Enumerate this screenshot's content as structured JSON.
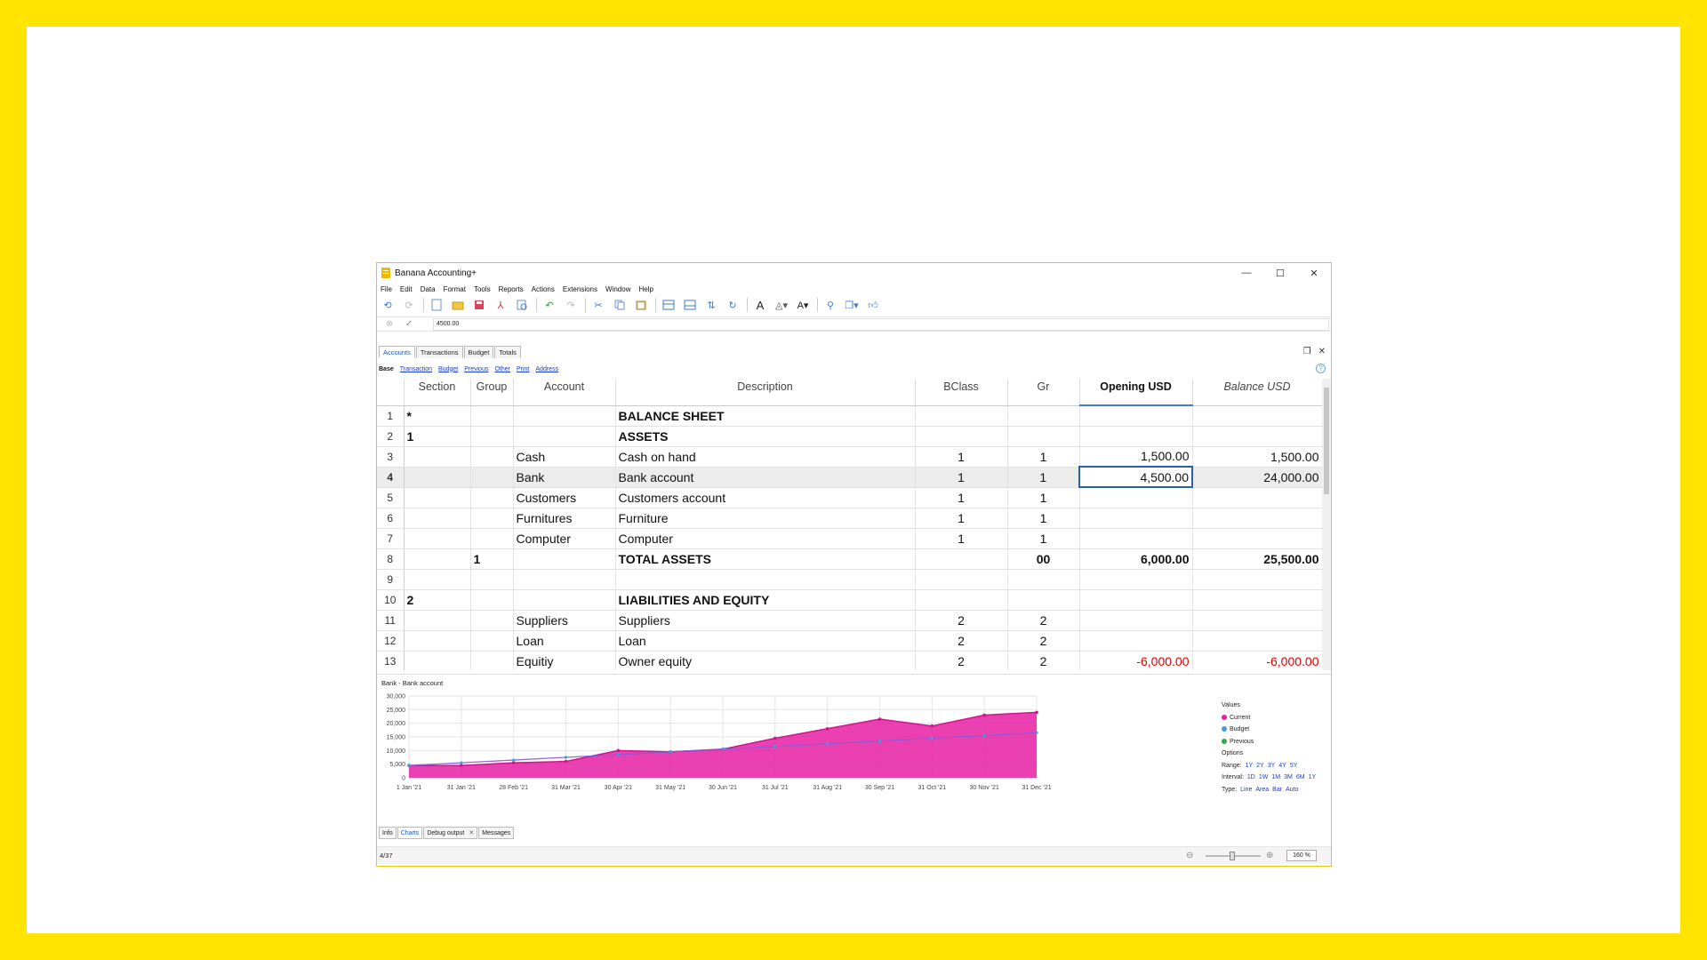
{
  "window": {
    "title": "Banana Accounting+"
  },
  "window_controls": {
    "minimize": "—",
    "maximize": "☐",
    "close": "✕"
  },
  "menu": [
    "File",
    "Edit",
    "Data",
    "Format",
    "Tools",
    "Reports",
    "Actions",
    "Extensions",
    "Window",
    "Help"
  ],
  "formula_bar": {
    "value": "4500.00"
  },
  "tabs": [
    "Accounts",
    "Transactions",
    "Budget",
    "Totals"
  ],
  "subtabs": [
    "Base",
    "Transaction",
    "Budget",
    "Previous",
    "Other",
    "Print",
    "Address"
  ],
  "table": {
    "headers": [
      "Section",
      "Group",
      "Account",
      "Description",
      "BClass",
      "Gr",
      "Opening USD",
      "Balance USD"
    ],
    "rows": [
      {
        "n": "1",
        "section": "*",
        "group": "",
        "account": "",
        "desc": "BALANCE SHEET",
        "bclass": "",
        "gr": "",
        "opening": "",
        "balance": ""
      },
      {
        "n": "2",
        "section": "1",
        "group": "",
        "account": "",
        "desc": "ASSETS",
        "bclass": "",
        "gr": "",
        "opening": "",
        "balance": ""
      },
      {
        "n": "3",
        "section": "",
        "group": "",
        "account": "Cash",
        "desc": "Cash on hand",
        "bclass": "1",
        "gr": "1",
        "opening": "1,500.00",
        "balance": "1,500.00"
      },
      {
        "n": "4",
        "section": "",
        "group": "",
        "account": "Bank",
        "desc": "Bank account",
        "bclass": "1",
        "gr": "1",
        "opening": "4,500.00",
        "balance": "24,000.00"
      },
      {
        "n": "5",
        "section": "",
        "group": "",
        "account": "Customers",
        "desc": "Customers account",
        "bclass": "1",
        "gr": "1",
        "opening": "",
        "balance": ""
      },
      {
        "n": "6",
        "section": "",
        "group": "",
        "account": "Furnitures",
        "desc": "Furniture",
        "bclass": "1",
        "gr": "1",
        "opening": "",
        "balance": ""
      },
      {
        "n": "7",
        "section": "",
        "group": "",
        "account": "Computer",
        "desc": "Computer",
        "bclass": "1",
        "gr": "1",
        "opening": "",
        "balance": ""
      },
      {
        "n": "8",
        "section": "",
        "group": "1",
        "account": "",
        "desc": "TOTAL ASSETS",
        "bclass": "",
        "gr": "00",
        "opening": "6,000.00",
        "balance": "25,500.00"
      },
      {
        "n": "9",
        "section": "",
        "group": "",
        "account": "",
        "desc": "",
        "bclass": "",
        "gr": "",
        "opening": "",
        "balance": ""
      },
      {
        "n": "10",
        "section": "2",
        "group": "",
        "account": "",
        "desc": "LIABILITIES AND EQUITY",
        "bclass": "",
        "gr": "",
        "opening": "",
        "balance": ""
      },
      {
        "n": "11",
        "section": "",
        "group": "",
        "account": "Suppliers",
        "desc": "Suppliers",
        "bclass": "2",
        "gr": "2",
        "opening": "",
        "balance": ""
      },
      {
        "n": "12",
        "section": "",
        "group": "",
        "account": "Loan",
        "desc": "Loan",
        "bclass": "2",
        "gr": "2",
        "opening": "",
        "balance": ""
      },
      {
        "n": "13",
        "section": "",
        "group": "",
        "account": "Equitiy",
        "desc": "Owner equity",
        "bclass": "2",
        "gr": "2",
        "opening": "-6,000.00",
        "balance": "-6,000.00"
      }
    ]
  },
  "chart_panel": {
    "title": "Bank - Bank account",
    "legend": {
      "values_label": "Values",
      "current": "Current",
      "budget": "Budget",
      "previous": "Previous",
      "options_label": "Options",
      "range_label": "Range:",
      "range": [
        "1Y",
        "2Y",
        "3Y",
        "4Y",
        "5Y"
      ],
      "interval_label": "Interval:",
      "interval": [
        "1D",
        "1W",
        "1M",
        "3M",
        "6M",
        "1Y"
      ],
      "type_label": "Type:",
      "type": [
        "Line",
        "Area",
        "Bar",
        "Auto"
      ]
    }
  },
  "chart_data": {
    "type": "area",
    "x": [
      "1 Jan '21",
      "31 Jan '21",
      "28 Feb '21",
      "31 Mar '21",
      "30 Apr '21",
      "31 May '21",
      "30 Jun '21",
      "31 Jul '21",
      "31 Aug '21",
      "30 Sep '21",
      "31 Oct '21",
      "30 Nov '21",
      "31 Dec '21"
    ],
    "yticks": [
      "0",
      "5,000",
      "10,000",
      "15,000",
      "20,000",
      "25,000",
      "30,000"
    ],
    "ylim": [
      0,
      30000
    ],
    "series": [
      {
        "name": "Current",
        "values": [
          4500,
          4500,
          5500,
          6000,
          10000,
          9500,
          10500,
          14500,
          18000,
          21500,
          19000,
          23000,
          24000
        ],
        "color": "#e81ea3"
      },
      {
        "name": "Budget",
        "values": [
          4500,
          5500,
          6500,
          7500,
          8500,
          9500,
          10500,
          11500,
          12500,
          13500,
          14500,
          15500,
          16500
        ],
        "color": "#3ca0e0"
      }
    ],
    "grid": true
  },
  "bottom_tabs": [
    "Info",
    "Charts",
    "Debug output",
    "Messages"
  ],
  "status": {
    "position": "4/37",
    "zoom": "160 %"
  },
  "colors": {
    "frame": "#ffe400",
    "accent": "#1a56c9",
    "negative": "#e00000",
    "area": "#e81ea3"
  }
}
